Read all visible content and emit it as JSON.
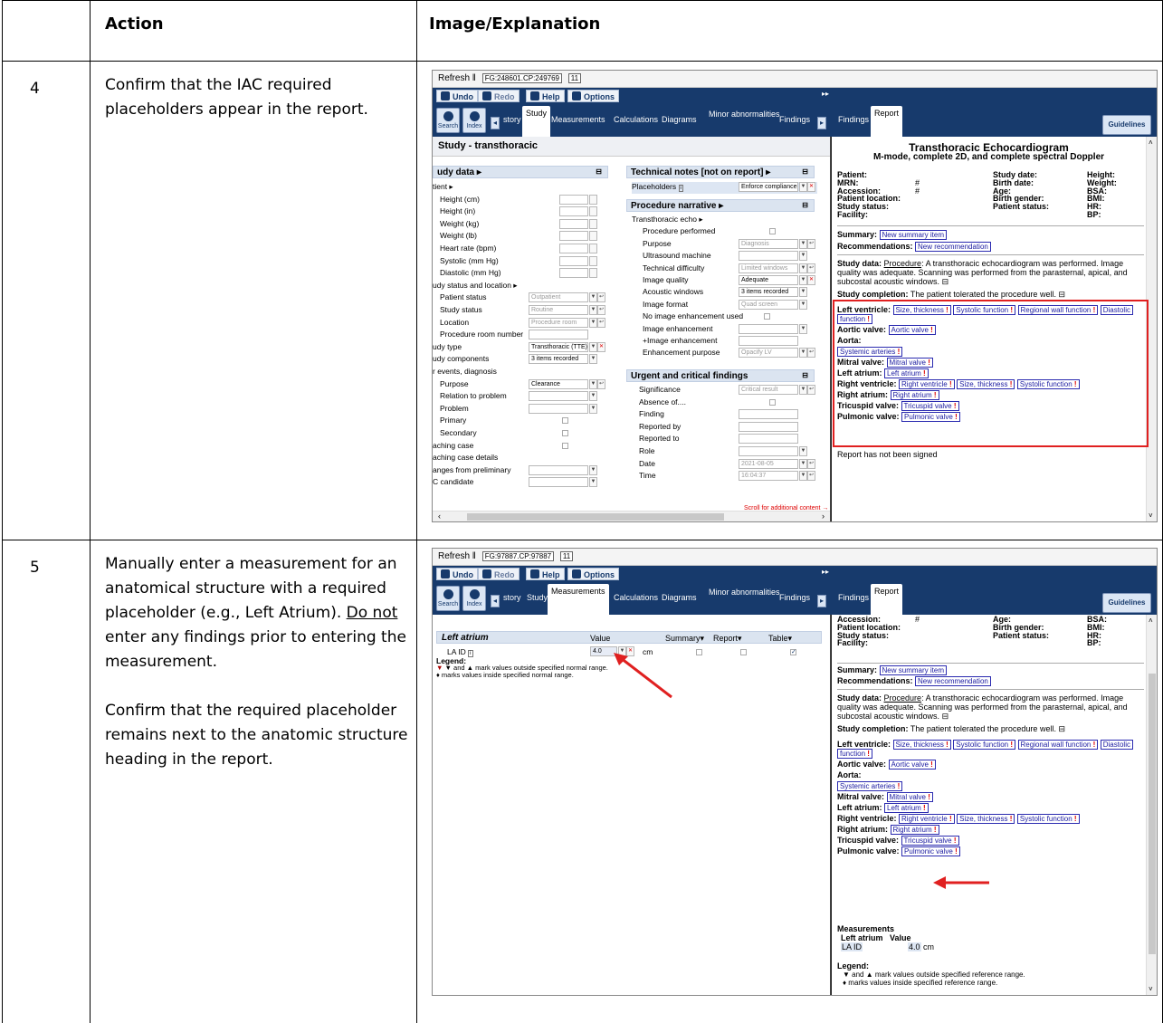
{
  "table": {
    "header": {
      "step": "",
      "action": "Action",
      "image": "Image/Explanation"
    },
    "rows": [
      {
        "step": "4",
        "action": "Confirm that the IAC required placeholders appear in the report."
      },
      {
        "step": "5",
        "action_parts": [
          "Manually enter a measurement for an anatomical structure with a required placeholder (e.g., Left Atrium). ",
          "Do not",
          " enter any findings prior to entering the measurement.",
          "Confirm that the required placeholder remains next to the anatomic structure heading in the report."
        ]
      }
    ]
  },
  "app": {
    "refresh": "Refresh",
    "fg1": "FG:248601.CP:249769",
    "fg2": "FG:97887.CP:97887",
    "fgnum": "11",
    "undo": "Undo",
    "redo": "Redo",
    "help": "Help",
    "options": "Options",
    "search": "Search",
    "index": "Index",
    "tabs": {
      "history": "story",
      "study": "Study",
      "measurements": "Measurements",
      "calculations": "Calculations",
      "diagrams": "Diagrams",
      "minor": "Minor abnormalities",
      "findings": "Findings"
    },
    "rtabs": {
      "findings": "Findings",
      "report": "Report",
      "guidelines": "Guidelines"
    }
  },
  "s1": {
    "title": "Study - transthoracic",
    "studydata": "udy data ▸",
    "left_rows": [
      "tient ▸",
      "Height (cm)",
      "Height (in)",
      "Weight (kg)",
      "Weight (lb)",
      "Heart rate (bpm)",
      "Systolic (mm Hg)",
      "Diastolic (mm Hg)",
      "udy status and location ▸",
      "Patient status",
      "Study status",
      "Location",
      "Procedure room number",
      "udy type",
      "udy components",
      "r events, diagnosis",
      "Purpose",
      "Relation to problem",
      "Problem",
      "Primary",
      "Secondary",
      "aching case",
      "aching case details",
      "anges from preliminary",
      "C candidate"
    ],
    "left_vals": {
      "patient_status": "Outpatient",
      "study_status": "Routine",
      "location": "Procedure room",
      "study_type": "Transthoracic (TTE)",
      "components": "3 items recorded",
      "purpose": "Clearance"
    },
    "tech_notes": "Technical notes [not on report] ▸",
    "placeholders": "Placeholders",
    "enforce": "Enforce compliance",
    "proc_narr": "Procedure narrative ▸",
    "proc_rows": [
      "Transthoracic echo ▸",
      "Procedure performed",
      "Purpose",
      "Ultrasound machine",
      "Technical difficulty",
      "Image quality",
      "Acoustic windows",
      "Image format",
      "No image enhancement used",
      "Image enhancement",
      "+Image enhancement",
      "Enhancement purpose"
    ],
    "proc_vals": {
      "purpose": "Diagnosis",
      "difficulty": "Limited windows",
      "quality": "Adequate",
      "windows": "3 items recorded",
      "format": "Quad screen",
      "enh_purpose": "Opacify LV"
    },
    "urgent": "Urgent and critical findings",
    "urgent_rows": [
      "Significance",
      "Absence of....",
      "Finding",
      "Reported by",
      "Reported to",
      "Role",
      "Date",
      "Time"
    ],
    "urgent_vals": {
      "significance": "Critical result",
      "date": "2021-08-05",
      "time": "16:04:37"
    },
    "scroll_note": "Scroll for additional content →"
  },
  "report": {
    "title": "Transthoracic Echocardiogram",
    "subtitle": "M-mode, complete 2D, and complete spectral Doppler",
    "c1": [
      "Patient:",
      "MRN:",
      "Accession:",
      "Patient location:",
      "Study status:",
      "Facility:"
    ],
    "c1v": [
      "",
      "#",
      "#",
      "",
      "",
      ""
    ],
    "c2": [
      "Study date:",
      "Birth date:",
      "Age:",
      "Birth gender:",
      "Patient status:"
    ],
    "c3": [
      "Height:",
      "Weight:",
      "BSA:",
      "BMI:",
      "HR:",
      "BP:"
    ],
    "summary_label": "Summary:",
    "summary_tag": "New summary item",
    "rec_label": "Recommendations:",
    "rec_tag": "New recommendation",
    "study_data_label": "Study data:",
    "procedure": "Procedure",
    "study_text1": ": A transthoracic echocardiogram was performed. Image",
    "study_text2": "quality was adequate. Scanning was performed from the parasternal, apical, and",
    "study_text3": "subcostal acoustic windows.",
    "completion_label": "Study completion:",
    "completion_text": "The patient tolerated the procedure well.",
    "lv": "Left ventricle:",
    "lv_tags": [
      "Size, thickness",
      "Systolic function",
      "Regional wall function",
      "Diastolic"
    ],
    "lv_tag_cont": "function",
    "av": "Aortic valve:",
    "av_tag": "Aortic valve",
    "aorta": "Aorta:",
    "aorta_tag": "Systemic arteries",
    "mv": "Mitral valve:",
    "mv_tag": "Mitral valve",
    "la": "Left atrium:",
    "la_tag": "Left atrium",
    "rv": "Right ventricle:",
    "rv_tags": [
      "Right ventricle",
      "Size, thickness",
      "Systolic function"
    ],
    "ra": "Right atrium:",
    "ra_tag": "Right atrium",
    "tv": "Tricuspid valve:",
    "tv_tag": "Tricuspid valve",
    "pv": "Pulmonic valve:",
    "pv_tag": "Pulmonic valve",
    "not_signed": "Report has not been signed",
    "meas_title": "Measurements",
    "meas_hdr1": "Left atrium",
    "meas_hdr2": "Value",
    "meas_name": "LA ID",
    "meas_val": "4.0",
    "meas_unit": "cm",
    "legend": "Legend:",
    "legend1": "▼ and ▲ mark values outside specified reference range.",
    "legend2": "♦ marks values inside specified reference range."
  },
  "s2": {
    "section": "Left atrium",
    "cols": [
      "Value",
      "Summary▾",
      "Report▾",
      "Table▾"
    ],
    "la_id": "LA ID",
    "value": "4.0",
    "unit": "cm",
    "legend": "Legend:",
    "legend1": "▼ and ▲ mark values outside specified normal range.",
    "legend2": "♦ marks values inside specified normal range."
  },
  "colors": {
    "navy": "#173a6c",
    "highlight": "#e02020",
    "tag": "#1a1aa0"
  }
}
